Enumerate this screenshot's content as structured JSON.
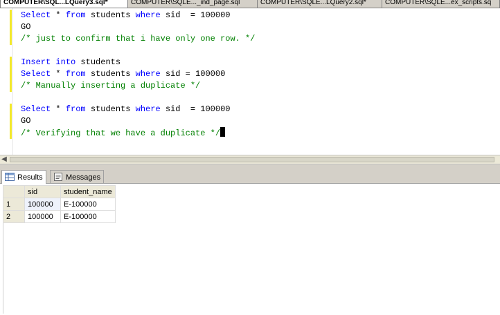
{
  "tabs": [
    {
      "label": "COMPUTER\\SQL...LQuery3.sql*",
      "active": true
    },
    {
      "label": "COMPUTER\\SQLE..._ind_page.sql",
      "active": false
    },
    {
      "label": "COMPUTER\\SQLE...LQuery2.sql*",
      "active": false
    },
    {
      "label": "COMPUTER\\SQLE...ex_scripts.sq",
      "active": false
    }
  ],
  "editor": {
    "lines": [
      [
        {
          "t": "Select",
          "c": "kw"
        },
        {
          "t": " * ",
          "c": "tx"
        },
        {
          "t": "from",
          "c": "kw"
        },
        {
          "t": " students ",
          "c": "tx"
        },
        {
          "t": "where",
          "c": "kw"
        },
        {
          "t": " sid  = 100000",
          "c": "tx"
        }
      ],
      [
        {
          "t": "GO",
          "c": "tx"
        }
      ],
      [
        {
          "t": "/* just to confirm that i have only one row. */",
          "c": "cm"
        }
      ],
      [],
      [
        {
          "t": "Insert",
          "c": "kw"
        },
        {
          "t": " ",
          "c": "tx"
        },
        {
          "t": "into",
          "c": "kw"
        },
        {
          "t": " students",
          "c": "tx"
        }
      ],
      [
        {
          "t": "Select",
          "c": "kw"
        },
        {
          "t": " * ",
          "c": "tx"
        },
        {
          "t": "from",
          "c": "kw"
        },
        {
          "t": " students ",
          "c": "tx"
        },
        {
          "t": "where",
          "c": "kw"
        },
        {
          "t": " sid = 100000",
          "c": "tx"
        }
      ],
      [
        {
          "t": "/* Manually inserting a duplicate */",
          "c": "cm"
        }
      ],
      [],
      [
        {
          "t": "Select",
          "c": "kw"
        },
        {
          "t": " * ",
          "c": "tx"
        },
        {
          "t": "from",
          "c": "kw"
        },
        {
          "t": " students ",
          "c": "tx"
        },
        {
          "t": "where",
          "c": "kw"
        },
        {
          "t": " sid  = 100000",
          "c": "tx"
        }
      ],
      [
        {
          "t": "GO",
          "c": "tx"
        }
      ],
      [
        {
          "t": "/* Verifying that we have a duplicate */",
          "c": "cm"
        }
      ]
    ],
    "changed_line_ranges": [
      [
        0,
        2
      ],
      [
        4,
        6
      ],
      [
        8,
        10
      ]
    ]
  },
  "results": {
    "tabs": [
      {
        "label": "Results",
        "icon": "grid-icon",
        "active": true
      },
      {
        "label": "Messages",
        "icon": "messages-icon",
        "active": false
      }
    ],
    "columns": [
      "sid",
      "student_name"
    ],
    "rows": [
      {
        "num": "1",
        "cells": [
          "100000",
          "E-100000"
        ]
      },
      {
        "num": "2",
        "cells": [
          "100000",
          "E-100000"
        ]
      }
    ]
  },
  "colors": {
    "keyword": "#0000ff",
    "comment": "#008000",
    "change_marker": "#f2e82b"
  }
}
